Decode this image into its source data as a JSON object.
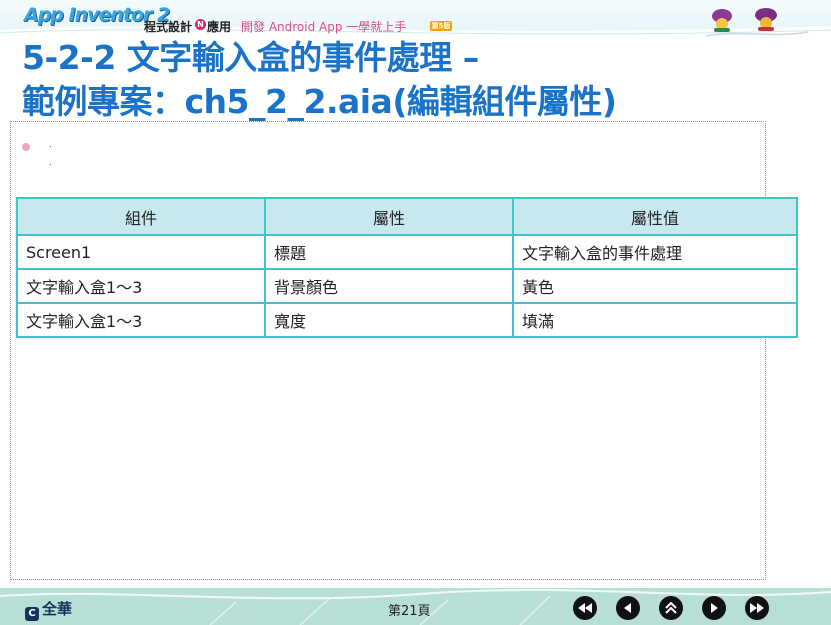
{
  "header": {
    "logo_word": "App Inventor 2",
    "logo_zh": "程式設計",
    "logo_badge": "N",
    "logo_app": "應用",
    "logo_subtitle": "開發 Android App 一學就上手",
    "logo_edition": "第5版",
    "colors": {
      "accent": "#1a73c8",
      "banner": "#e6f4f8"
    }
  },
  "title": {
    "line1": "5-2-2 文字輸入盒的事件處理 –",
    "line2": "範例專案：ch5_2_2.aia(編輯組件屬性)"
  },
  "table": {
    "headers": [
      "組件",
      "屬性",
      "屬性值"
    ],
    "rows": [
      [
        "Screen1",
        "標題",
        "文字輸入盒的事件處理"
      ],
      [
        "文字輸入盒1～3",
        "背景顏色",
        "黃色"
      ],
      [
        "文字輸入盒1～3",
        "寬度",
        "填滿"
      ]
    ],
    "colors": {
      "header_bg": "#c8e8f0",
      "border": "#45c0cf"
    }
  },
  "footer": {
    "brand": "全華",
    "page_label": "第21頁",
    "nav": [
      "first-page-icon",
      "previous-page-icon",
      "home-icon",
      "next-page-icon",
      "last-page-icon"
    ]
  }
}
